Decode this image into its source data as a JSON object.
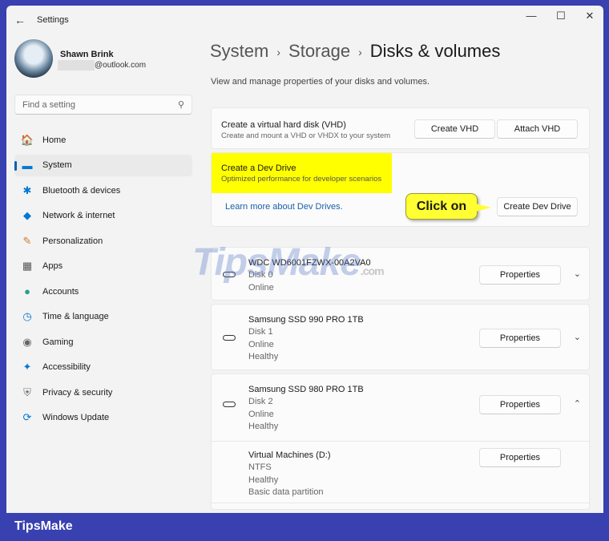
{
  "window": {
    "title": "Settings",
    "minimize": "—",
    "maximize": "☐",
    "close": "✕"
  },
  "user": {
    "name": "Shawn Brink",
    "email_suffix": "@outlook.com"
  },
  "search": {
    "placeholder": "Find a setting"
  },
  "nav": [
    {
      "label": "Home",
      "icon": "🏠",
      "color": "#c75"
    },
    {
      "label": "System",
      "icon": "▬",
      "color": "#0078d4"
    },
    {
      "label": "Bluetooth & devices",
      "icon": "✱",
      "color": "#0078d4"
    },
    {
      "label": "Network & internet",
      "icon": "◆",
      "color": "#0078d4"
    },
    {
      "label": "Personalization",
      "icon": "✎",
      "color": "#d07a30"
    },
    {
      "label": "Apps",
      "icon": "▦",
      "color": "#555"
    },
    {
      "label": "Accounts",
      "icon": "●",
      "color": "#2a9d8f"
    },
    {
      "label": "Time & language",
      "icon": "◷",
      "color": "#0078d4"
    },
    {
      "label": "Gaming",
      "icon": "◉",
      "color": "#666"
    },
    {
      "label": "Accessibility",
      "icon": "✦",
      "color": "#0078d4"
    },
    {
      "label": "Privacy & security",
      "icon": "⛨",
      "color": "#777"
    },
    {
      "label": "Windows Update",
      "icon": "⟳",
      "color": "#0078d4"
    }
  ],
  "breadcrumb": [
    "System",
    "Storage",
    "Disks & volumes"
  ],
  "description": "View and manage properties of your disks and volumes.",
  "vhd": {
    "title": "Create a virtual hard disk (VHD)",
    "subtitle": "Create and mount a VHD or VHDX to your system",
    "create": "Create VHD",
    "attach": "Attach VHD"
  },
  "devdrive": {
    "title": "Create a Dev Drive",
    "subtitle": "Optimized performance for developer scenarios",
    "link": "Learn more about Dev Drives.",
    "button": "Create Dev Drive",
    "callout": "Click on"
  },
  "disks": [
    {
      "name": "WDC WD6001FZWX-00A2VA0",
      "lines": [
        "Disk 0",
        "Online"
      ],
      "button": "Properties",
      "chevron": "⌄"
    },
    {
      "name": "Samsung SSD 990 PRO 1TB",
      "lines": [
        "Disk 1",
        "Online",
        "Healthy"
      ],
      "button": "Properties",
      "chevron": "⌄"
    },
    {
      "name": "Samsung SSD 980 PRO 1TB",
      "lines": [
        "Disk 2",
        "Online",
        "Healthy"
      ],
      "button": "Properties",
      "chevron": "⌃"
    }
  ],
  "volume": {
    "name": "Virtual Machines (D:)",
    "lines": [
      "NTFS",
      "Healthy",
      "Basic data partition"
    ],
    "button": "Properties"
  },
  "watermark": {
    "text": "TipsMake",
    ".com": ".com"
  },
  "footer": "TipsMake"
}
